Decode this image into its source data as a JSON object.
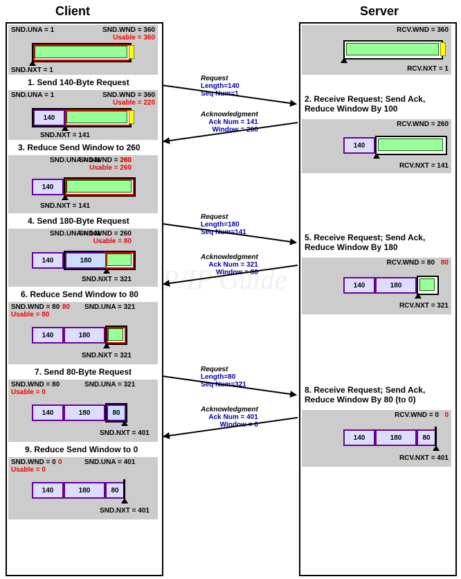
{
  "headers": {
    "client": "Client",
    "server": "Server"
  },
  "watermark": "The   TCP/IP   Guide",
  "client": {
    "p1": {
      "snduna": "SND.UNA = 1",
      "sndwnd": "SND.WND = 360",
      "usable": "Usable = 360",
      "sndnxt": "SND.NXT = 1"
    },
    "s1": "1. Send 140-Byte Request",
    "p2": {
      "snduna": "SND.UNA = 1",
      "sndwnd": "SND.WND = 360",
      "usable": "Usable = 220",
      "sndnxt": "SND.NXT = 141",
      "seg1": "140"
    },
    "s3": "3. Reduce Send Window to 260",
    "p3": {
      "snduna": "SND.UNA = 141",
      "sndwnd": "SND.WND = 260",
      "usable": "Usable = 260",
      "sndnxt": "SND.NXT = 141",
      "seg1": "140"
    },
    "s4": "4. Send 180-Byte Request",
    "p4": {
      "snduna": "SND.UNA = 141",
      "sndwnd": "SND.WND = 260",
      "usable": "Usable = 80",
      "sndnxt": "SND.NXT = 321",
      "seg1": "140",
      "seg2": "180"
    },
    "s6": "6. Reduce Send Window to 80",
    "p5": {
      "sndwnd": "SND.WND = 80",
      "usable": "Usable = 80",
      "snduna": "SND.UNA = 321",
      "sndnxt": "SND.NXT = 321",
      "seg1": "140",
      "seg2": "180"
    },
    "s7": "7. Send 80-Byte Request",
    "p6": {
      "sndwnd": "SND.WND = 80",
      "usable": "Usable = 0",
      "snduna": "SND.UNA = 321",
      "sndnxt": "SND.NXT = 401",
      "seg1": "140",
      "seg2": "180",
      "seg3": "80"
    },
    "s9": "9. Reduce Send Window to 0",
    "p7": {
      "sndwnd": "SND.WND = 0",
      "usable": "Usable = 0",
      "snduna": "SND.UNA = 401",
      "sndnxt": "SND.NXT = 401",
      "seg1": "140",
      "seg2": "180",
      "seg3": "80"
    }
  },
  "server": {
    "p1": {
      "rcvwnd": "RCV.WND = 360",
      "rcvnxt": "RCV.NXT = 1"
    },
    "s2": "2. Receive Request; Send Ack,",
    "s2b": "Reduce Window By 100",
    "p2": {
      "rcvwnd": "RCV.WND = 260",
      "rcvnxt": "RCV.NXT = 141",
      "seg1": "140"
    },
    "s5": "5. Receive Request; Send Ack,",
    "s5b": "Reduce Window By 180",
    "p3": {
      "rcvwnd": "RCV.WND = 80",
      "rcvnxt": "RCV.NXT = 321",
      "seg1": "140",
      "seg2": "180"
    },
    "s8": "8. Receive Request; Send Ack,",
    "s8b": "Reduce Window By 80 (to 0)",
    "p4": {
      "rcvwnd": "RCV.WND = 0",
      "rcvnxt": "RCV.NXT = 401",
      "seg1": "140",
      "seg2": "180",
      "seg3": "80"
    }
  },
  "msgs": {
    "m1": {
      "t": "Request",
      "l1": "Length=140",
      "l2": "Seq Num=1"
    },
    "m2": {
      "t": "Acknowledgment",
      "l1": "Ack Num = 141",
      "l2": "Window = 260"
    },
    "m3": {
      "t": "Request",
      "l1": "Length=180",
      "l2": "Seq Num=141"
    },
    "m4": {
      "t": "Acknowledgment",
      "l1": "Ack Num = 321",
      "l2": "Window = 80"
    },
    "m5": {
      "t": "Request",
      "l1": "Length=80",
      "l2": "Seq Num=321"
    },
    "m6": {
      "t": "Acknowledgment",
      "l1": "Ack Num = 401",
      "l2": "Window = 0"
    }
  }
}
